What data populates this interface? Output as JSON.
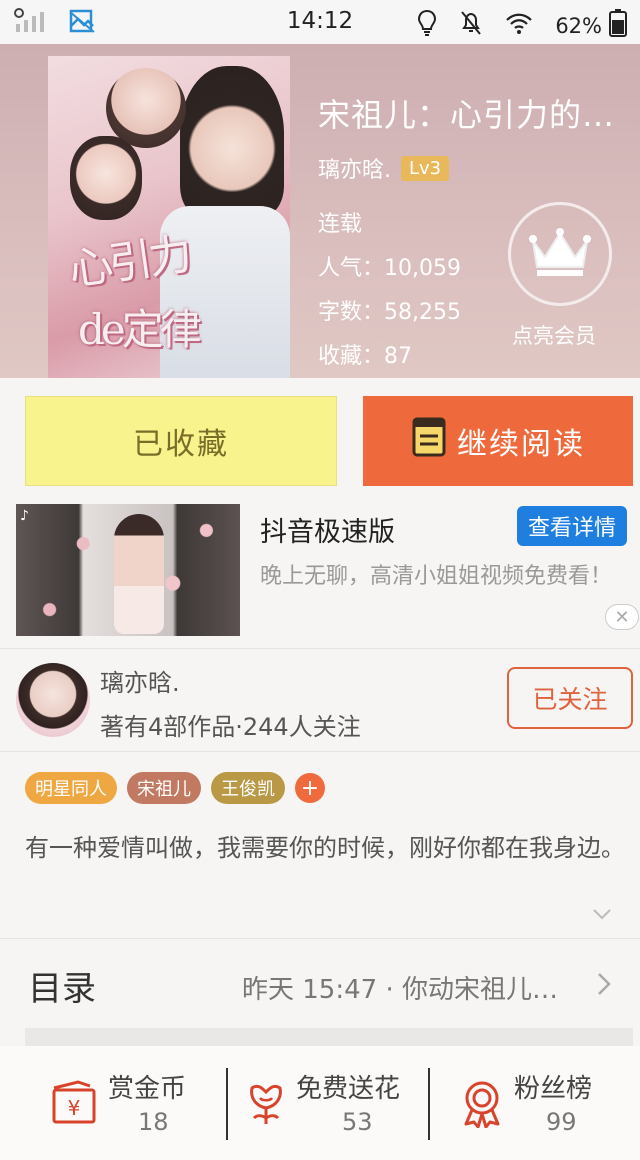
{
  "status_bar": {
    "time": "14:12",
    "battery": "62%",
    "icons": [
      "signal-icon",
      "image-icon",
      "bulb-icon",
      "mute-icon",
      "wifi-icon",
      "battery-icon"
    ]
  },
  "book": {
    "title": "宋祖儿：心引力的…",
    "author": "璃亦晗.",
    "level": "Lv3",
    "status": "连载",
    "popularity": "人气：10,059",
    "word_count": "字数：58,255",
    "collections": "收藏：87",
    "cover_text_1": "心引力",
    "cover_text_2": "de定律"
  },
  "vip": {
    "label": "点亮会员"
  },
  "actions": {
    "collected_label": "已收藏",
    "continue_label": "继续阅读"
  },
  "ad": {
    "title": "抖音极速版",
    "button": "查看详情",
    "description": "晚上无聊，高清小姐姐视频免费看！"
  },
  "author_card": {
    "name": "璃亦晗.",
    "stats": "著有4部作品·244人关注",
    "follow_label": "已关注"
  },
  "tags": [
    "明星同人",
    "宋祖儿",
    "王俊凯"
  ],
  "intro": "有一种爱情叫做，我需要你的时候，刚好你都在我身边。",
  "toc": {
    "title": "目录",
    "latest": "昨天 15:47 · 你动宋祖儿…"
  },
  "bottom": {
    "reward_label": "赏金币",
    "reward_count": "18",
    "flower_label": "免费送花",
    "flower_count": "53",
    "fans_label": "粉丝榜",
    "fans_count": "99"
  },
  "colors": {
    "accent_orange": "#ee6a3c",
    "collected_yellow": "#f8f38c",
    "ad_blue": "#1f7fe0",
    "level_gold": "#e9b85a"
  }
}
